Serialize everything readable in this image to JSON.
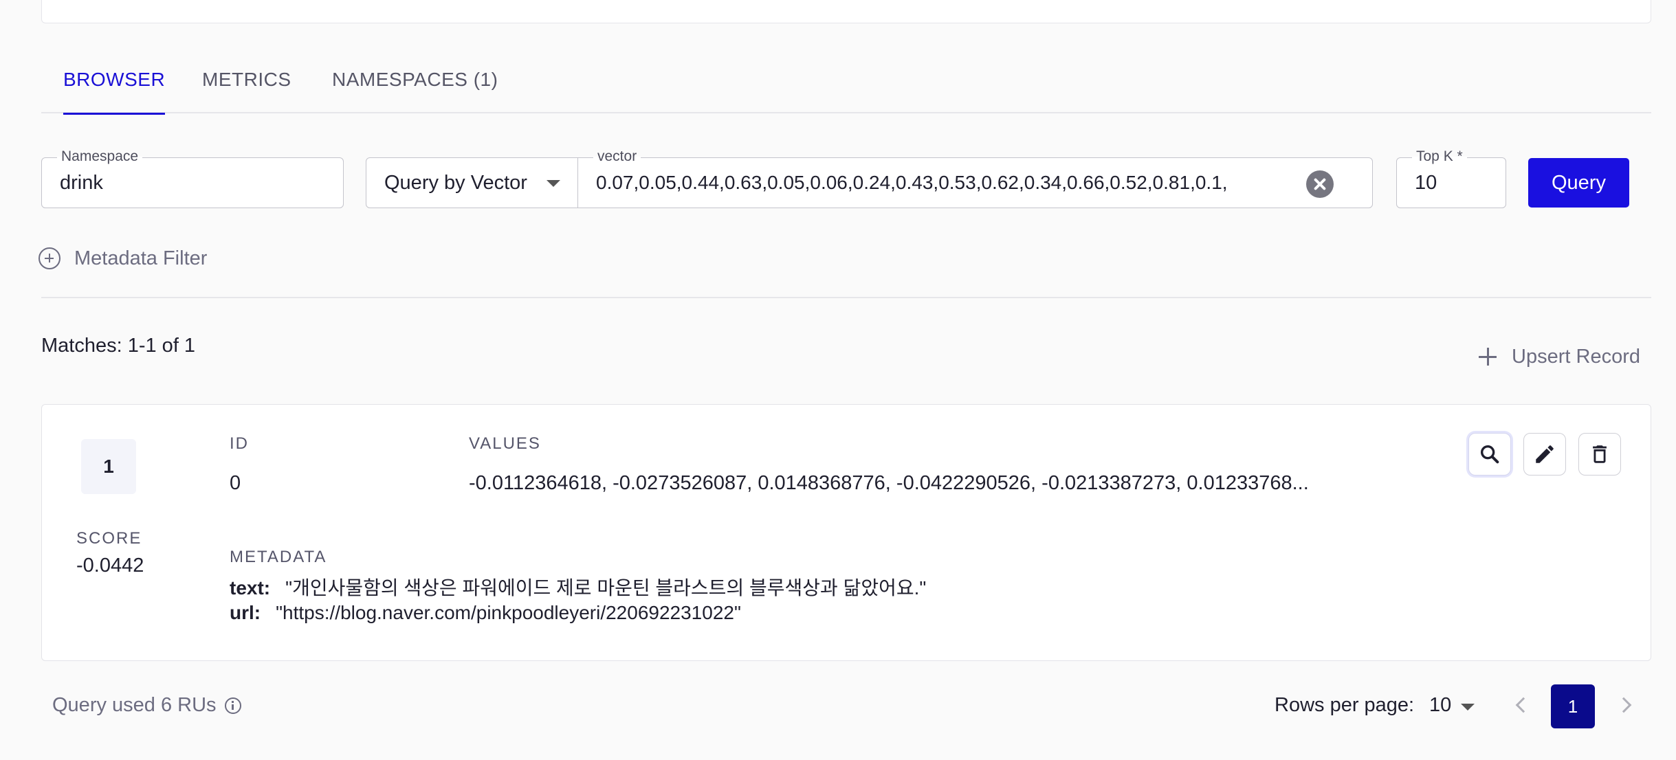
{
  "tabs": [
    {
      "label": "BROWSER"
    },
    {
      "label": "METRICS"
    },
    {
      "label": "NAMESPACES (1)"
    }
  ],
  "query": {
    "namespace_label": "Namespace",
    "namespace_value": "drink",
    "mode_value": "Query by Vector",
    "vector_label": "vector",
    "vector_value": "0.07,0.05,0.44,0.63,0.05,0.06,0.24,0.43,0.53,0.62,0.34,0.66,0.52,0.81,0.1,",
    "topk_label": "Top K *",
    "topk_value": "10",
    "query_button": "Query"
  },
  "metadata_filter_label": "Metadata Filter",
  "matches_text": "Matches: 1-1 of 1",
  "upsert_label": "Upsert Record",
  "record": {
    "rank": "1",
    "score_label": "SCORE",
    "score": "-0.0442",
    "id_label": "ID",
    "id": "0",
    "values_label": "VALUES",
    "values": "-0.0112364618, -0.0273526087, 0.0148368776, -0.0422290526, -0.0213387273, 0.01233768...",
    "metadata_label": "METADATA",
    "metadata": {
      "text_key": "text:",
      "text_value": "\"개인사물함의 색상은 파워에이드 제로 마운틴 블라스트의 블루색상과 닮았어요.\"",
      "url_key": "url:",
      "url_value": "\"https://blog.naver.com/pinkpoodleyeri/220692231022\""
    },
    "actions": [
      "search-icon",
      "pencil-icon",
      "trash-icon"
    ]
  },
  "footer": {
    "ru_text": "Query used 6 RUs",
    "rows_per_page_label": "Rows per page:",
    "rows_per_page_value": "10",
    "current_page": "1"
  },
  "colors": {
    "accent": "#1a10e0",
    "page_active": "#0a0a8c",
    "muted": "#6c6c80"
  }
}
